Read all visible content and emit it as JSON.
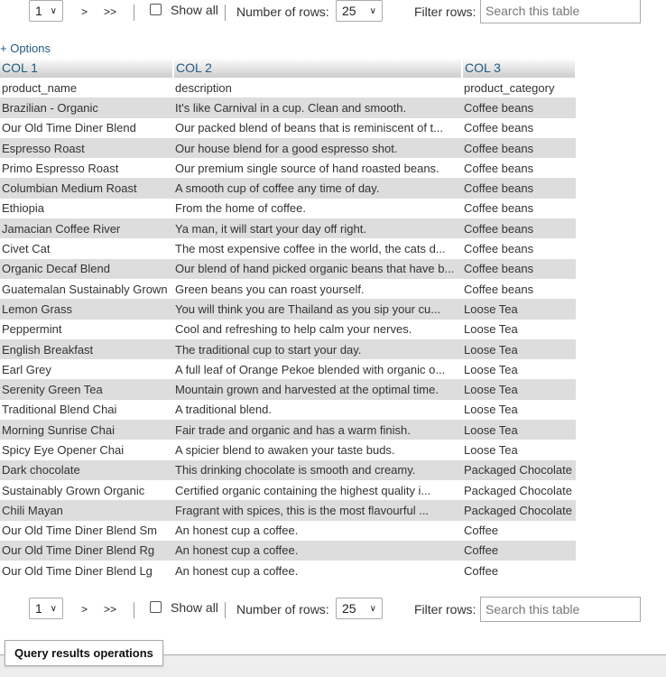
{
  "nav": {
    "page": "1",
    "next": ">",
    "last": ">>",
    "show_all": "Show all",
    "rows_label": "Number of rows:",
    "rows_value": "25",
    "filter_label": "Filter rows:",
    "filter_placeholder": "Search this table"
  },
  "options": "+ Options",
  "columns": [
    "COL 1",
    "COL 2",
    "COL 3"
  ],
  "rows": [
    [
      "product_name",
      "description",
      "product_category"
    ],
    [
      "Brazilian - Organic",
      "It's like Carnival in a cup. Clean and smooth.",
      "Coffee beans"
    ],
    [
      "Our Old Time Diner Blend",
      "Our packed blend of beans that is reminiscent of t...",
      "Coffee beans"
    ],
    [
      "Espresso Roast",
      "Our house blend for a good espresso shot.",
      "Coffee beans"
    ],
    [
      "Primo Espresso Roast",
      "Our premium single source of hand roasted beans.",
      "Coffee beans"
    ],
    [
      "Columbian Medium Roast",
      "A smooth cup of coffee any time of day.",
      "Coffee beans"
    ],
    [
      "Ethiopia",
      "From the home of coffee.",
      "Coffee beans"
    ],
    [
      "Jamacian Coffee River",
      "Ya man, it will start your day off right.",
      "Coffee beans"
    ],
    [
      "Civet Cat",
      "The most expensive coffee in the world, the cats d...",
      "Coffee beans"
    ],
    [
      "Organic Decaf Blend",
      "Our blend of hand picked organic beans that have b...",
      "Coffee beans"
    ],
    [
      "Guatemalan Sustainably Grown",
      "Green beans you can roast yourself.",
      "Coffee beans"
    ],
    [
      "Lemon Grass",
      "You will think you are Thailand as you sip your cu...",
      "Loose Tea"
    ],
    [
      "Peppermint",
      "Cool and refreshing to help calm your nerves.",
      "Loose Tea"
    ],
    [
      "English Breakfast",
      "The traditional cup to start your day.",
      "Loose Tea"
    ],
    [
      "Earl Grey",
      "A full leaf of Orange Pekoe blended with organic o...",
      "Loose Tea"
    ],
    [
      "Serenity Green Tea",
      "Mountain grown and harvested at the optimal time.",
      "Loose Tea"
    ],
    [
      "Traditional Blend Chai",
      "A traditional blend.",
      "Loose Tea"
    ],
    [
      "Morning Sunrise Chai",
      "Fair trade and organic and has a warm finish.",
      "Loose Tea"
    ],
    [
      "Spicy Eye Opener Chai",
      "A spicier blend to awaken your taste buds.",
      "Loose Tea"
    ],
    [
      "Dark chocolate",
      "This drinking chocolate is smooth and creamy.",
      "Packaged Chocolate"
    ],
    [
      "Sustainably Grown Organic",
      "Certified organic containing the highest quality i...",
      "Packaged Chocolate"
    ],
    [
      "Chili Mayan",
      "Fragrant with spices, this is the most flavourful ...",
      "Packaged Chocolate"
    ],
    [
      "Our Old Time Diner Blend Sm",
      "An honest cup a coffee.",
      "Coffee"
    ],
    [
      "Our Old Time Diner Blend Rg",
      "An honest cup a coffee.",
      "Coffee"
    ],
    [
      "Our Old Time Diner Blend Lg",
      "An honest cup a coffee.",
      "Coffee"
    ]
  ],
  "query_ops": "Query results operations"
}
